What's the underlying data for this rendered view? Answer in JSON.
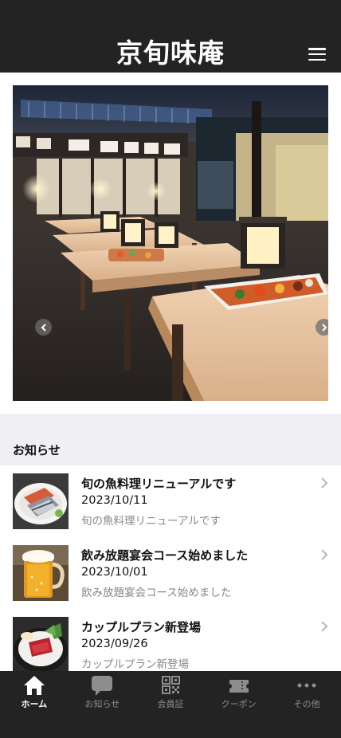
{
  "header": {
    "title": "京旬味庵",
    "menu_icon": "hamburger-menu-icon"
  },
  "carousel": {
    "image": "restaurant-interior-photo",
    "prev_icon": "chevron-left-icon",
    "next_icon": "chevron-right-icon"
  },
  "news": {
    "section_title": "お知らせ",
    "items": [
      {
        "title": "旬の魚料理リニューアルです",
        "date": "2023/10/11",
        "description": "旬の魚料理リニューアルです",
        "thumbnail": "grilled-fish-photo"
      },
      {
        "title": "飲み放題宴会コース始めました",
        "date": "2023/10/01",
        "description": "飲み放題宴会コース始めました",
        "thumbnail": "beer-mug-photo"
      },
      {
        "title": "カップルプラン新登場",
        "date": "2023/09/26",
        "description": "カップルプラン新登場",
        "thumbnail": "sashimi-platter-photo"
      }
    ]
  },
  "tabbar": {
    "items": [
      {
        "label": "ホーム",
        "icon": "home-icon",
        "active": true
      },
      {
        "label": "お知らせ",
        "icon": "chat-bubble-icon",
        "active": false
      },
      {
        "label": "会員証",
        "icon": "qr-code-icon",
        "active": false
      },
      {
        "label": "クーポン",
        "icon": "ticket-icon",
        "active": false
      },
      {
        "label": "その他",
        "icon": "more-dots-icon",
        "active": false
      }
    ]
  },
  "colors": {
    "header_bg": "#232323",
    "tabbar_bg": "#232323",
    "section_bg": "#efeff4",
    "muted_text": "#888888"
  }
}
